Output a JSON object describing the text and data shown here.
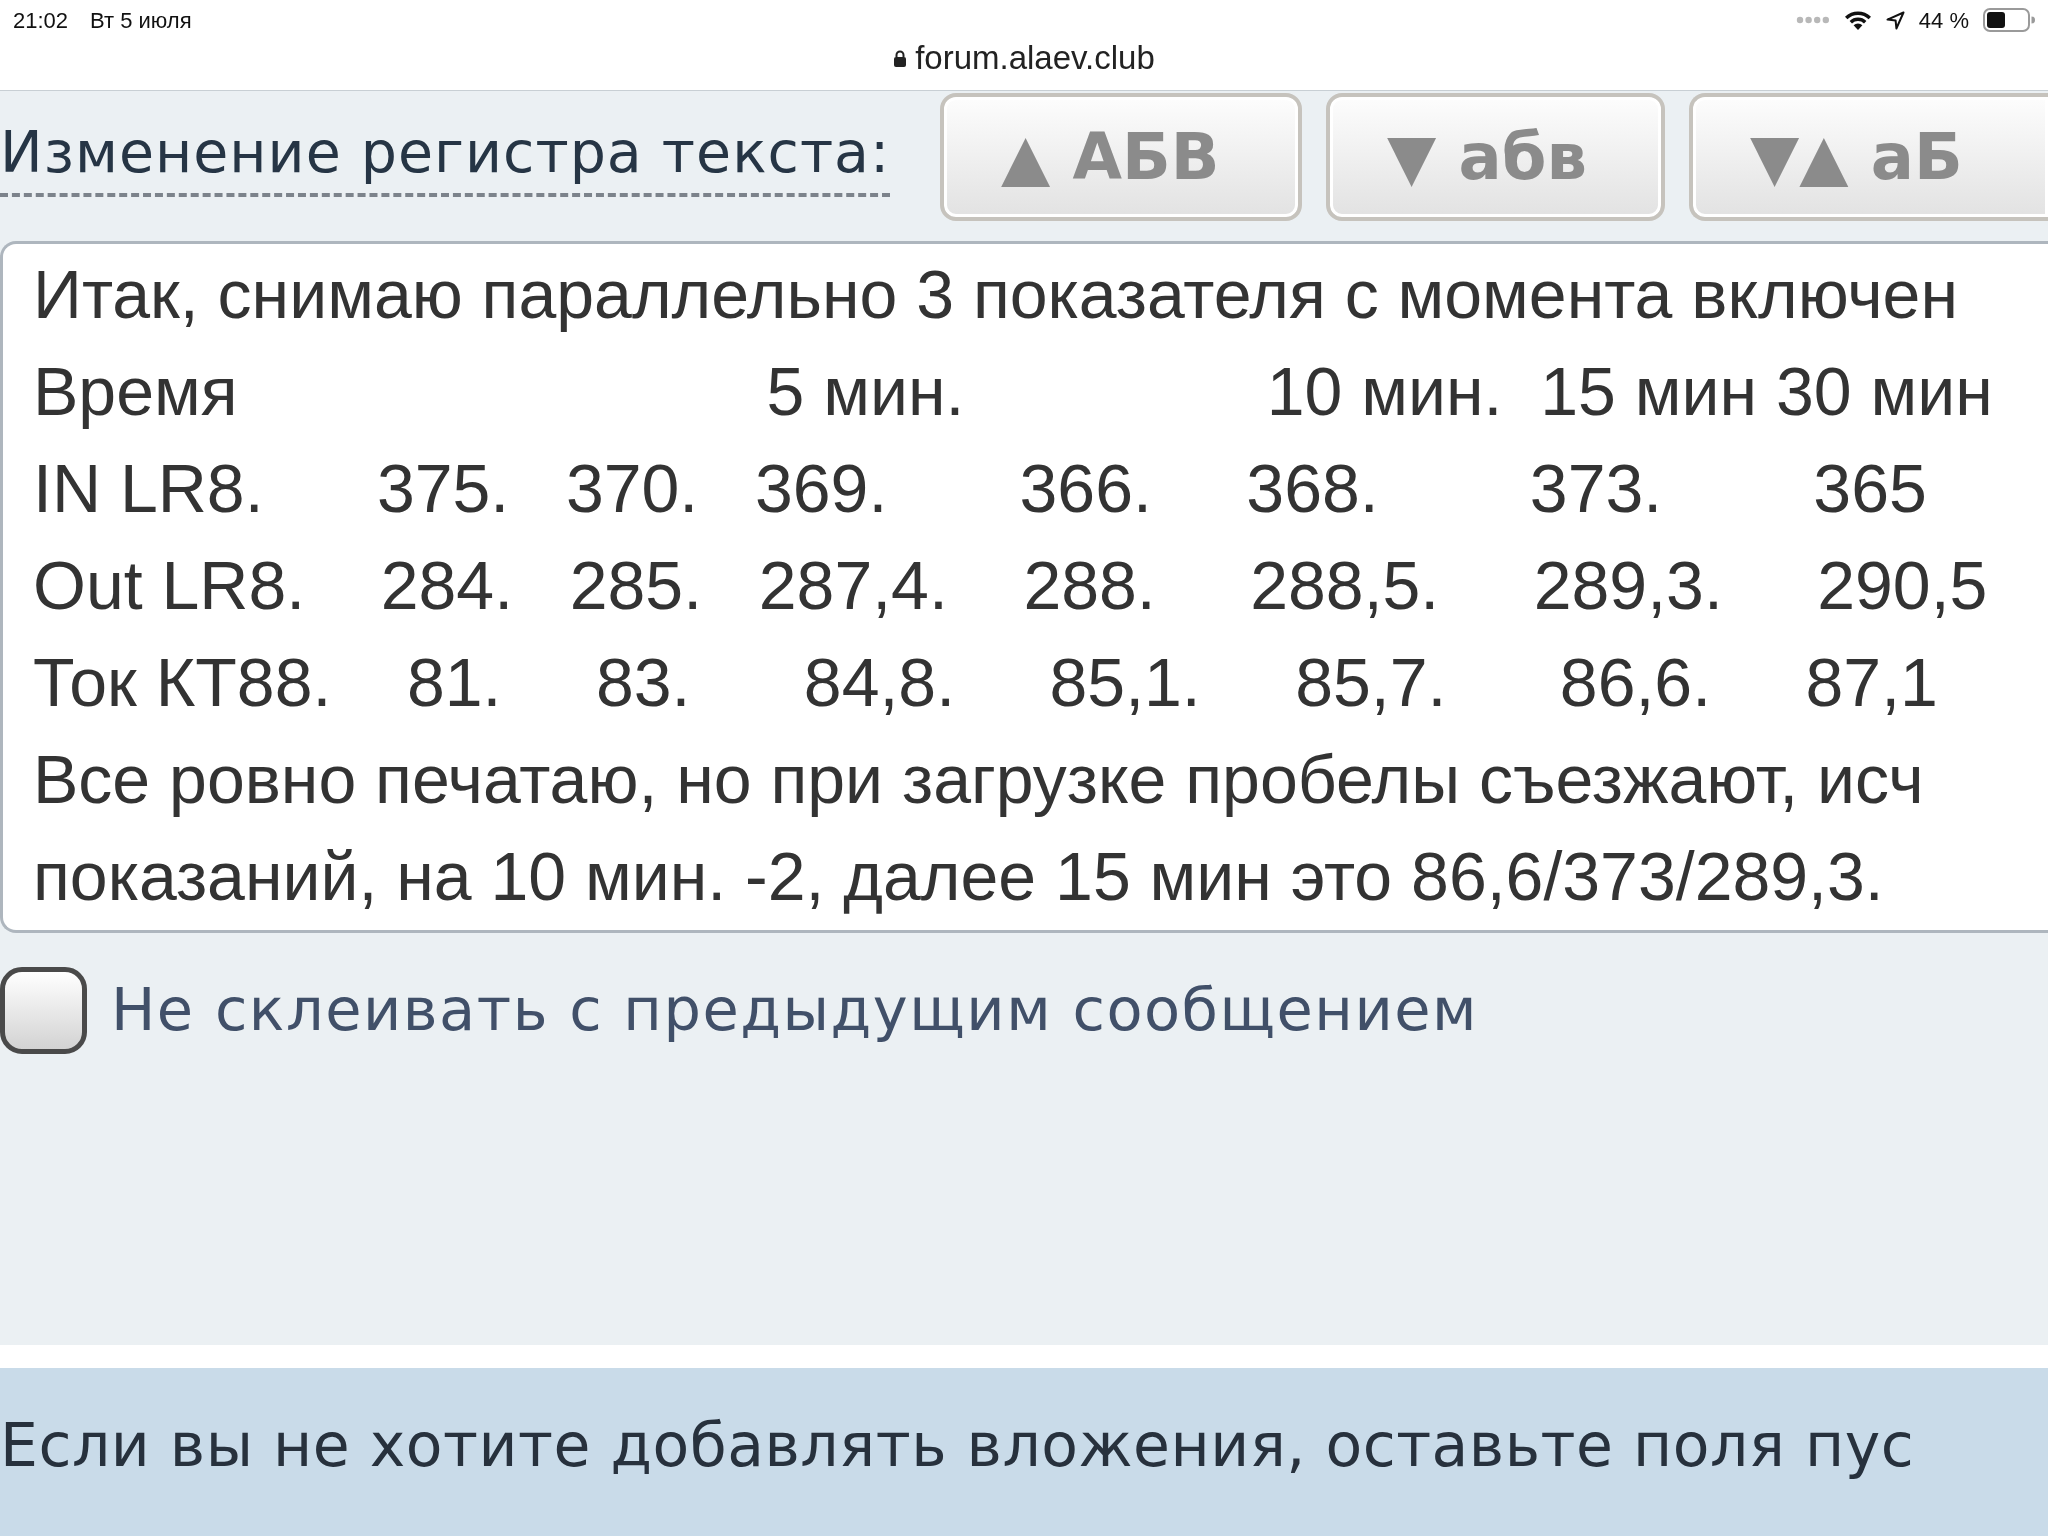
{
  "status_bar": {
    "time": "21:02",
    "date": "Вт 5 июля",
    "url": "forum.alaev.club",
    "battery": "44 %"
  },
  "case_toolbar": {
    "label": "Изменение регистра текста:",
    "buttons": [
      "▲ АБВ",
      "▼ абв",
      "▼▲ аБ"
    ]
  },
  "message": {
    "lines": [
      "Итак, снимаю параллельно 3 показателя с момента включен",
      "Время                            5 мин.                10 мин.  15 мин 30 мин",
      "IN LR8.      375.   370.   369.       366.     368.        373.        365",
      "Out LR8.    284.   285.   287,4.    288.     288,5.     289,3.     290,5",
      "Ток КТ88.    81.     83.      84,8.     85,1.     85,7.      86,6.     87,1",
      "Все ровно печатаю, но при загрузке пробелы съезжают, исч",
      "показаний, на 10 мин. -2, далее 15 мин это 86,6/373/289,3."
    ]
  },
  "no_merge_checkbox": {
    "label": "Не склеивать с предыдущим сообщением",
    "checked": false
  },
  "attachments_notice": "Если вы не хотите добавлять вложения, оставьте поля пус"
}
